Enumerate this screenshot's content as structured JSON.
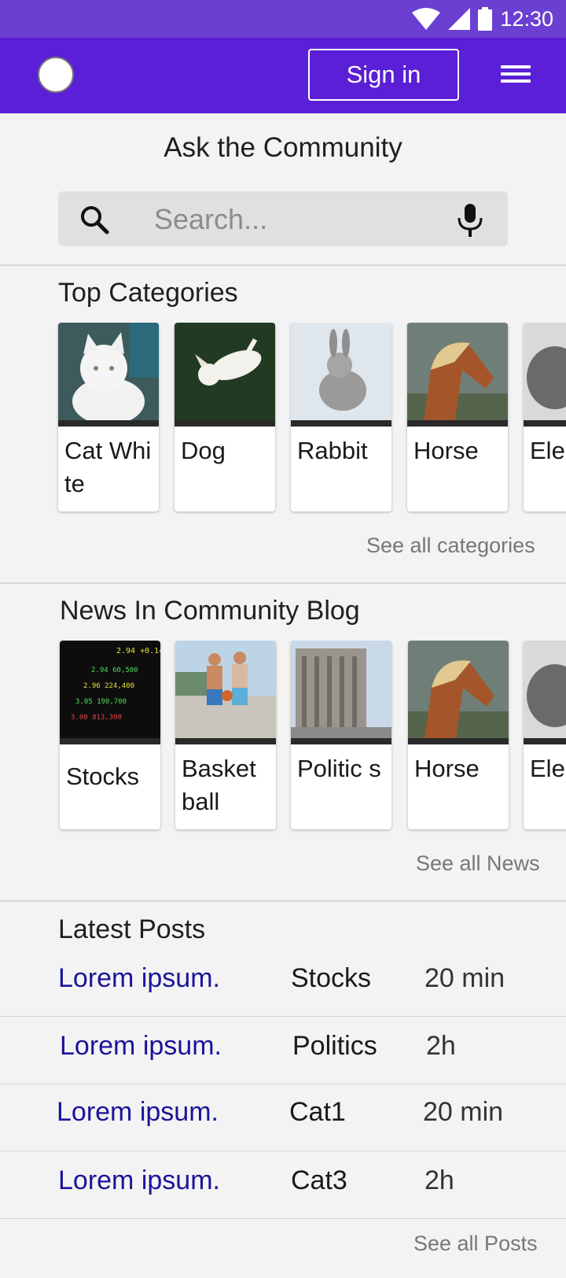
{
  "status_bar": {
    "time": "12:30"
  },
  "app_bar": {
    "sign_in_label": "Sign in"
  },
  "page_heading": "Ask the Community",
  "search": {
    "placeholder": "Search..."
  },
  "top_categories": {
    "title": "Top Categories",
    "items": [
      {
        "label": "Cat White",
        "icon": "cat-photo"
      },
      {
        "label": "Dog",
        "icon": "dog-photo"
      },
      {
        "label": "Rabbit",
        "icon": "rabbit-photo"
      },
      {
        "label": "Horse",
        "icon": "horse-photo"
      },
      {
        "label": "Elep",
        "icon": "elephant-photo"
      }
    ],
    "see_all_label": "See all categories"
  },
  "news": {
    "title": "News In Community Blog",
    "items": [
      {
        "label": "Stocks",
        "icon": "stocks-photo"
      },
      {
        "label": "Basket ball",
        "icon": "basketball-photo"
      },
      {
        "label": "Politic s",
        "icon": "politics-photo"
      },
      {
        "label": "Horse",
        "icon": "horse-photo"
      },
      {
        "label": "Ele",
        "icon": "elephant-photo"
      }
    ],
    "see_all_label": "See all News"
  },
  "latest_posts": {
    "title": "Latest Posts",
    "rows": [
      {
        "title": "Lorem ipsum.",
        "category": "Stocks",
        "time": "20 min"
      },
      {
        "title": "Lorem ipsum.",
        "category": "Politics",
        "time": "2h"
      },
      {
        "title": "Lorem ipsum.",
        "category": "Cat1",
        "time": "20 min"
      },
      {
        "title": "Lorem ipsum.",
        "category": "Cat3",
        "time": "2h"
      }
    ],
    "see_all_label": "See all Posts"
  },
  "colors": {
    "status_bar": "#6a3fd2",
    "app_bar": "#5a1fd6",
    "post_link": "#1a149a",
    "muted": "#777777"
  }
}
